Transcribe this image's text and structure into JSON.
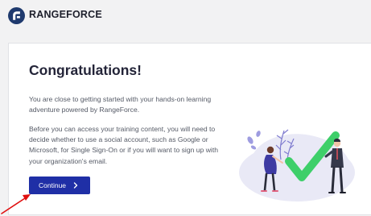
{
  "header": {
    "brand": "RANGEFORCE",
    "logo_icon": "rangeforce-logo-icon",
    "colors": {
      "logo": "#1f3a6e"
    }
  },
  "card": {
    "title": "Congratulations!",
    "paragraph1": "You are close to getting started with your hands-on learning adventure powered by RangeForce.",
    "paragraph2": "Before you can access your training content, you will need to decide whether to use a social account, such as Google or Microsoft, for Single Sign-On or if you will want to sign up with your organization's email.",
    "continue_label": "Continue",
    "continue_icon": "chevron-right-icon",
    "illustration": "congratulations-illustration",
    "colors": {
      "button": "#1f2fa6",
      "check": "#3ecf6a",
      "blob": "#e9e9f6"
    }
  },
  "annotation": {
    "arrow_icon": "red-pointer-arrow-icon",
    "color": "#e01010"
  }
}
